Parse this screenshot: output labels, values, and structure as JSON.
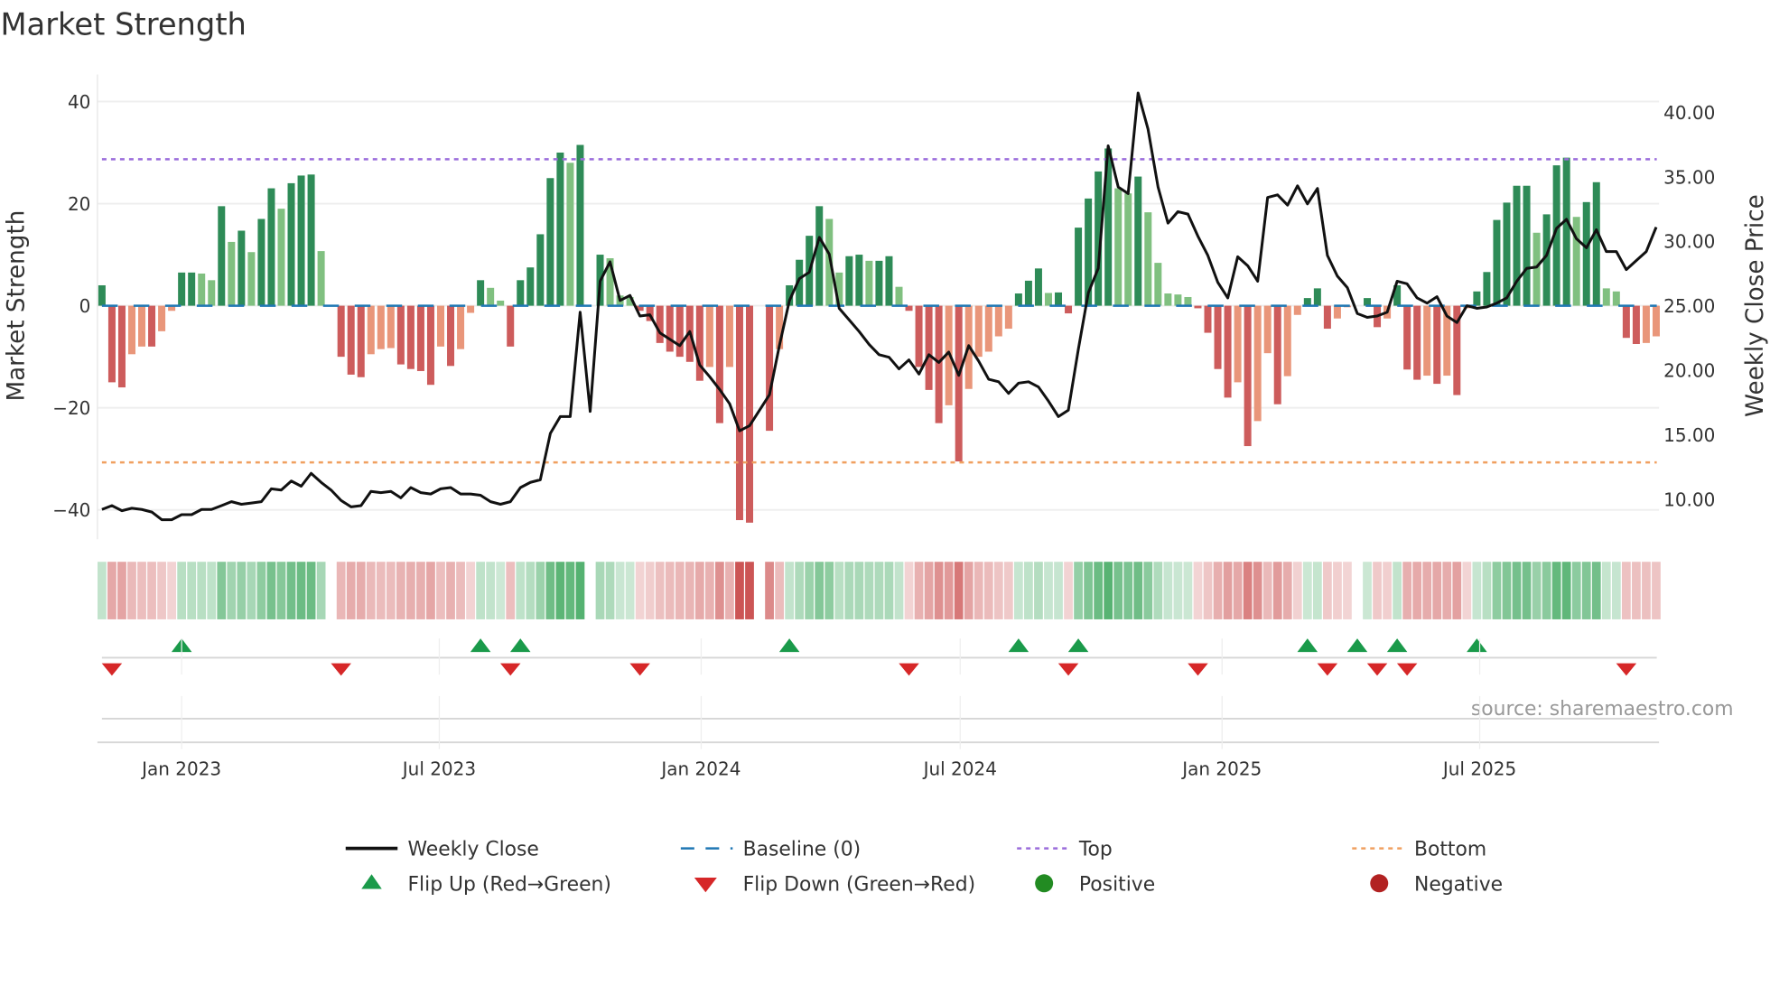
{
  "chart_data": {
    "type": "bar",
    "title": "Market Strength",
    "ylabel": "Market Strength",
    "y2label": "Weekly Close Price",
    "ylim": [
      -44,
      44
    ],
    "y2lim": [
      8.4,
      42.5
    ],
    "yticks": [
      40,
      20,
      0,
      -20,
      -40
    ],
    "yticklabels": [
      "40",
      "20",
      "0",
      "−20",
      "−40"
    ],
    "y2ticks": [
      40,
      35,
      30,
      25,
      20,
      15,
      10
    ],
    "y2ticklabels": [
      "40.00",
      "35.00",
      "30.00",
      "25.00",
      "20.00",
      "15.00",
      "10.00"
    ],
    "frequency": "weekly",
    "start_date": "2022-11-06",
    "xticks": [
      {
        "date": "2023-01-01",
        "label": "Jan 2023"
      },
      {
        "date": "2023-07-01",
        "label": "Jul 2023"
      },
      {
        "date": "2024-01-01",
        "label": "Jan 2024"
      },
      {
        "date": "2024-07-01",
        "label": "Jul 2024"
      },
      {
        "date": "2025-01-01",
        "label": "Jan 2025"
      },
      {
        "date": "2025-07-01",
        "label": "Jul 2025"
      }
    ],
    "top_level": 28.7,
    "bottom_level": -30.7,
    "baseline": 0,
    "strength": [
      4,
      -15,
      -16,
      -9.5,
      -8,
      -8,
      -5,
      -1,
      6.5,
      6.5,
      6.3,
      5,
      19.5,
      12.5,
      14.7,
      10.5,
      17,
      23,
      19,
      24,
      25.5,
      25.7,
      10.7,
      0,
      -10,
      -13.5,
      -14,
      -9.5,
      -8.5,
      -8.3,
      -11.5,
      -12.4,
      -12.8,
      -15.5,
      -8,
      -11.8,
      -8.5,
      -1.4,
      5,
      3.5,
      1,
      -8,
      5,
      7.5,
      14,
      25,
      30,
      28,
      31.5,
      0,
      10,
      9.3,
      2,
      1.7,
      -1,
      -3,
      -7.3,
      -9,
      -10,
      -11,
      -14.7,
      -12,
      -23,
      -12,
      -42,
      -42.5,
      0,
      -24.5,
      -8.5,
      4,
      9,
      13.7,
      19.5,
      17,
      6.5,
      9.7,
      10,
      8.8,
      8.8,
      9.7,
      3.7,
      -1,
      -12,
      -16.5,
      -23,
      -19.5,
      -30.5,
      -16.3,
      -10,
      -9,
      -6,
      -4.5,
      2.4,
      4.9,
      7.3,
      2.5,
      2.6,
      -1.5,
      15.3,
      21,
      26.3,
      30.8,
      23,
      22,
      25.3,
      18.3,
      8.4,
      2.4,
      2.2,
      1.7,
      -0.5,
      -5.3,
      -12.4,
      -18,
      -15,
      -27.5,
      -22.6,
      -9.3,
      -19.3,
      -13.8,
      -1.8,
      1.5,
      3.4,
      -4.5,
      -2.5,
      -0.3,
      0,
      1.5,
      -4.2,
      -2.5,
      4,
      -12.5,
      -14.5,
      -13.7,
      -15.3,
      -13.7,
      -17.5,
      -0.5,
      2.8,
      6.6,
      16.8,
      20.2,
      23.5,
      23.5,
      14.3,
      17.9,
      27.5,
      29,
      17.4,
      20.3,
      24.2,
      3.4,
      2.8,
      -6.3,
      -7.5,
      -7.3,
      -6
    ],
    "weekly_close": [
      9.2,
      9.5,
      9.1,
      9.3,
      9.2,
      9.0,
      8.4,
      8.4,
      8.8,
      8.8,
      9.2,
      9.2,
      9.5,
      9.8,
      9.6,
      9.7,
      9.8,
      10.8,
      10.7,
      11.4,
      11.0,
      12.0,
      11.3,
      10.7,
      9.9,
      9.4,
      9.5,
      10.6,
      10.5,
      10.6,
      10.1,
      10.9,
      10.5,
      10.4,
      10.8,
      10.9,
      10.4,
      10.4,
      10.3,
      9.8,
      9.6,
      9.8,
      10.9,
      11.3,
      11.5,
      15.1,
      16.4,
      16.4,
      24.5,
      16.8,
      26.9,
      28.4,
      25.4,
      25.8,
      24.2,
      24.3,
      22.9,
      22.4,
      21.9,
      23.0,
      20.4,
      19.5,
      18.5,
      17.4,
      15.3,
      15.7,
      16.9,
      18.1,
      21.9,
      25.4,
      27.1,
      27.6,
      30.3,
      29.0,
      24.8,
      23.9,
      23.0,
      22.0,
      21.2,
      21.0,
      20.1,
      20.8,
      19.7,
      21.2,
      20.6,
      21.4,
      19.6,
      21.9,
      20.7,
      19.3,
      19.1,
      18.2,
      19.0,
      19.1,
      18.7,
      17.6,
      16.4,
      16.9,
      21.6,
      26.0,
      27.9,
      37.4,
      34.2,
      33.7,
      41.5,
      38.7,
      34.2,
      31.4,
      32.3,
      32.1,
      30.4,
      28.9,
      26.8,
      25.6,
      28.8,
      28.1,
      26.9,
      33.4,
      33.6,
      32.8,
      34.3,
      32.9,
      34.1,
      28.9,
      27.3,
      26.4,
      24.4,
      24.1,
      24.2,
      24.5,
      26.9,
      26.7,
      25.6,
      25.2,
      25.7,
      24.2,
      23.7,
      25.0,
      24.8,
      24.9,
      25.2,
      25.6,
      26.9,
      27.9,
      28.0,
      28.9,
      31.0,
      31.7,
      30.2,
      29.5,
      30.9,
      29.2,
      29.2,
      27.8,
      28.5,
      29.2,
      31.1
    ],
    "flip_up_weeks": [
      8,
      38,
      42,
      69,
      92,
      98,
      121,
      126,
      130,
      138
    ],
    "flip_down_weeks": [
      1,
      24,
      41,
      54,
      81,
      97,
      110,
      123,
      128,
      131,
      153
    ],
    "source": "source: sharemaestro.com",
    "legend": {
      "placement": "bottom",
      "items": [
        {
          "label": "Weekly Close",
          "kind": "line-solid",
          "color": "#111111"
        },
        {
          "label": "Baseline (0)",
          "kind": "line-dashed",
          "color": "#1f77b4"
        },
        {
          "label": "Top",
          "kind": "line-dotted",
          "color": "#9b6ddb"
        },
        {
          "label": "Bottom",
          "kind": "line-dotted",
          "color": "#f0a060"
        },
        {
          "label": "Flip Up (Red→Green)",
          "kind": "triangle-up",
          "color": "#1a9a4a"
        },
        {
          "label": "Flip Down (Green→Red)",
          "kind": "triangle-down",
          "color": "#d62728"
        },
        {
          "label": "Positive",
          "kind": "dot",
          "color": "#228b22"
        },
        {
          "label": "Negative",
          "kind": "dot",
          "color": "#b22222"
        }
      ]
    },
    "colors": {
      "pos_strong": "#2e8b57",
      "pos_weak": "#80c080",
      "neg_strong": "#cd5c5c",
      "neg_weak": "#e9967a",
      "line": "#111111",
      "baseline": "#1f77b4",
      "top": "#9b6ddb",
      "bottom": "#f0a060"
    }
  }
}
